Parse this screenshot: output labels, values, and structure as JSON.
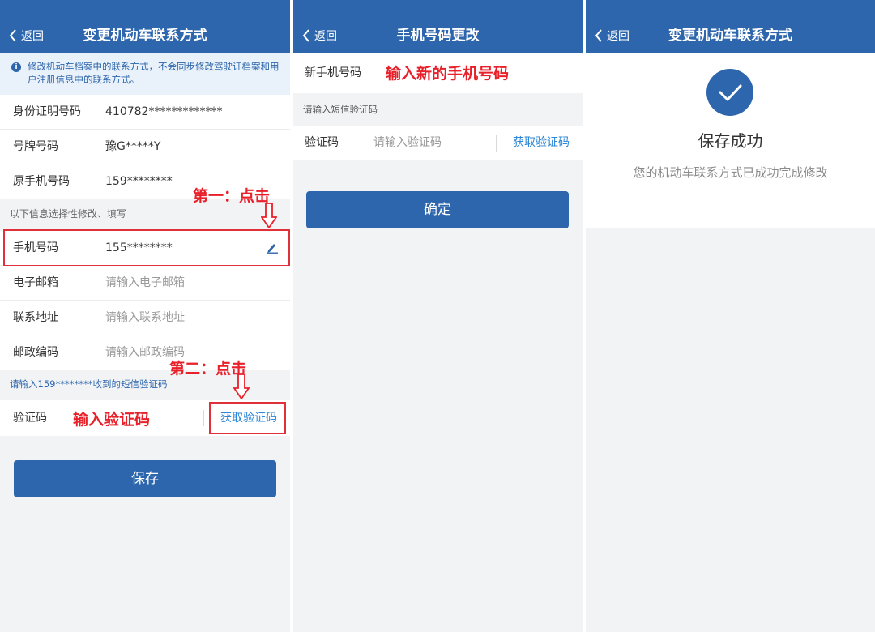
{
  "panel1": {
    "nav": {
      "back_label": "返回",
      "title": "变更机动车联系方式"
    },
    "notice": "修改机动车档案中的联系方式，不会同步修改驾驶证档案和用户注册信息中的联系方式。",
    "id_row": {
      "label": "身份证明号码",
      "value": "410782*************"
    },
    "plate_row": {
      "label": "号牌号码",
      "value": "豫G*****Y"
    },
    "orig_phone_row": {
      "label": "原手机号码",
      "value": "159********"
    },
    "optional_section": "以下信息选择性修改、填写",
    "phone_row": {
      "label": "手机号码",
      "value": "155********"
    },
    "email_row": {
      "label": "电子邮箱",
      "placeholder": "请输入电子邮箱"
    },
    "address_row": {
      "label": "联系地址",
      "placeholder": "请输入联系地址"
    },
    "postcode_row": {
      "label": "邮政编码",
      "placeholder": "请输入邮政编码"
    },
    "sms_section": "请输入159********收到的短信验证码",
    "code_row": {
      "label": "验证码",
      "get_code": "获取验证码"
    },
    "save_button": "保存",
    "annotations": {
      "step1": "第一：点击",
      "step2": "第二：点击",
      "enter_code": "输入验证码"
    }
  },
  "panel2": {
    "nav": {
      "back_label": "返回",
      "title": "手机号码更改"
    },
    "new_phone_row": {
      "label": "新手机号码"
    },
    "sms_section": "请输入短信验证码",
    "code_row": {
      "label": "验证码",
      "placeholder": "请输入验证码",
      "get_code": "获取验证码"
    },
    "confirm_button": "确定",
    "annotations": {
      "enter_new_phone": "输入新的手机号码"
    }
  },
  "panel3": {
    "nav": {
      "back_label": "返回",
      "title": "变更机动车联系方式"
    },
    "success_title": "保存成功",
    "success_message": "您的机动车联系方式已成功完成修改"
  },
  "colors": {
    "nav_blue": "#2d66ac",
    "link_blue": "#2d86d6",
    "annotation_red": "#e8202a",
    "background": "#f2f3f5"
  }
}
